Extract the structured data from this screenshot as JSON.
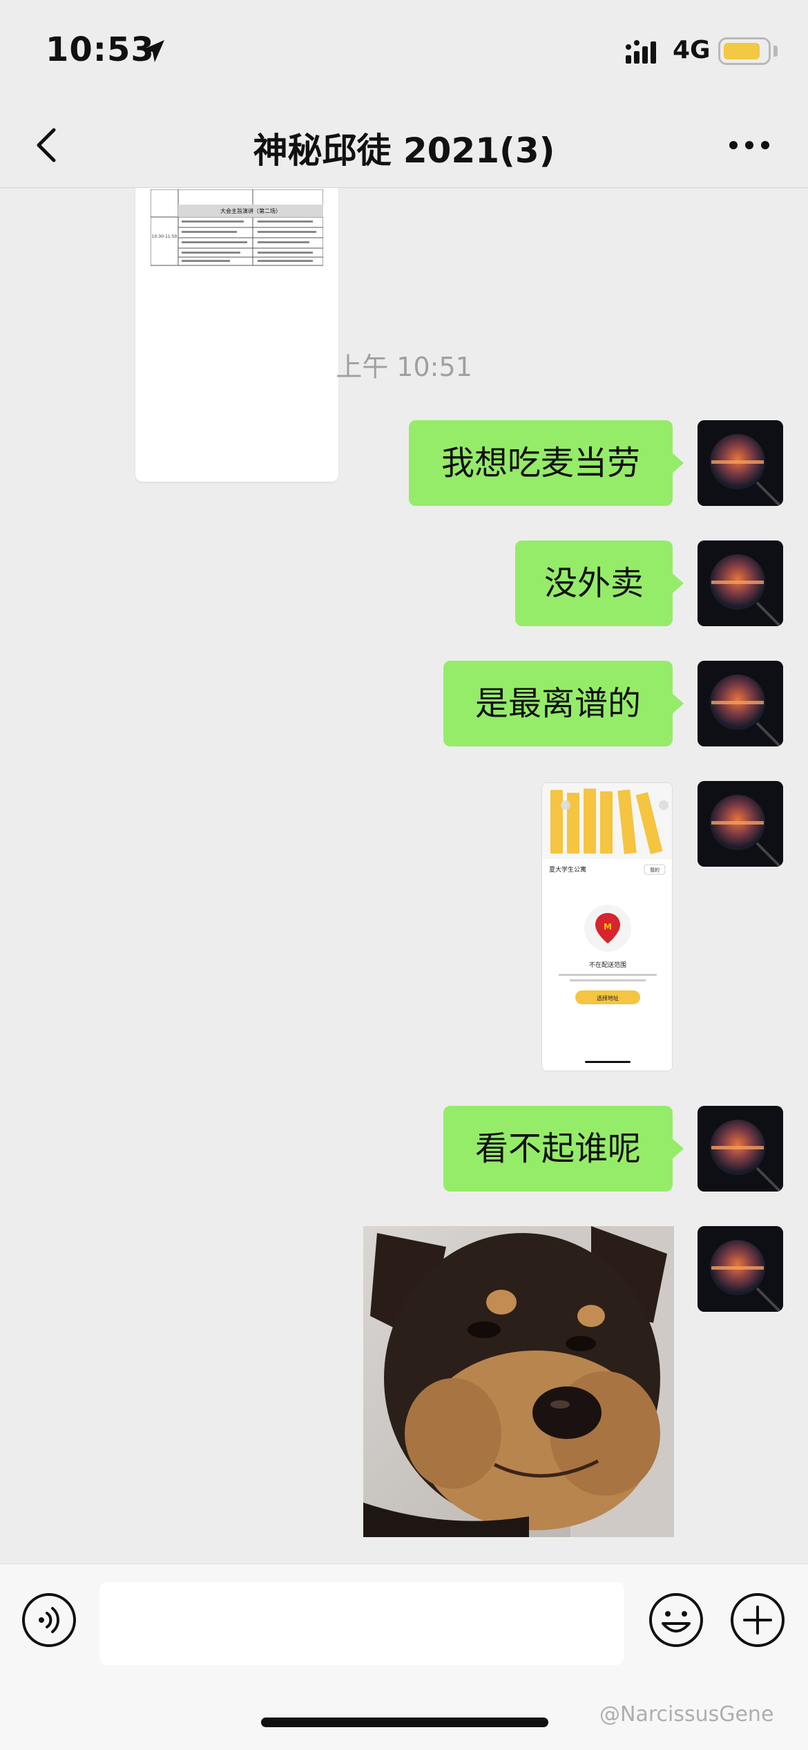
{
  "status_bar": {
    "time": "10:53",
    "network": "4G",
    "battery_color": "#f3c842"
  },
  "nav": {
    "title": "神秘邱徒 2021(3)",
    "back_icon": "chevron-left-icon",
    "more_icon": "more-dots-icon"
  },
  "chat": {
    "document_thumbnail": {
      "section_title": "大会主旨演讲（第二场）",
      "time_range": "10:30-11:50"
    },
    "timestamp": "上午 10:51",
    "messages": [
      {
        "type": "text",
        "text": "我想吃麦当劳"
      },
      {
        "type": "text",
        "text": "没外卖"
      },
      {
        "type": "text",
        "text": "是最离谱的"
      },
      {
        "type": "image",
        "screenshot": {
          "address": "夏大学生公寓",
          "status": "不在配送范围",
          "button": "选择地址",
          "mine": "我的"
        }
      },
      {
        "type": "text",
        "text": "看不起谁呢"
      },
      {
        "type": "sticker",
        "description_icon": "dog-sticker"
      }
    ]
  },
  "input_bar": {
    "voice_icon": "voice-icon",
    "emoji_icon": "emoji-icon",
    "plus_icon": "plus-icon",
    "input_value": ""
  },
  "watermark": "@NarcissusGene",
  "colors": {
    "bubble": "#95ec69",
    "background": "#ededed"
  }
}
